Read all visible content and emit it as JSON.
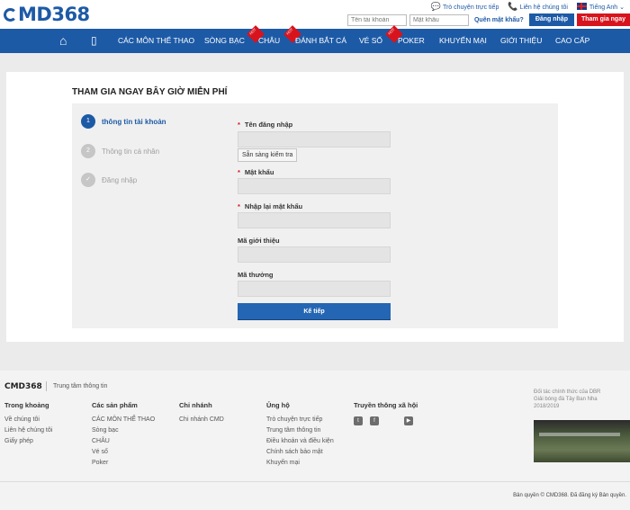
{
  "header": {
    "logo_text": "MD368",
    "top_links": [
      "Trò chuyện trực tiếp",
      "Liên hệ chúng tôi",
      "Tiếng Anh"
    ],
    "username_placeholder": "Tên tài khoản",
    "password_placeholder": "Mật khẩu",
    "forgot_label": "Quên mật khẩu?",
    "login_label": "Đăng nhập",
    "join_label": "Tham gia ngay"
  },
  "nav": {
    "items": [
      "Các môn thể thao",
      "Sòng bạc",
      "Châu",
      "Đánh bắt cá",
      "Vé số",
      "Poker",
      "Khuyến mại",
      "Giới thiệu",
      "Cao cấp"
    ],
    "hot_badge": "HOT"
  },
  "registration": {
    "title": "THAM GIA NGAY BÂY GIỜ MIỄN PHÍ",
    "steps": [
      {
        "num": "1",
        "label": "thông tin tài khoản"
      },
      {
        "num": "2",
        "label": "Thông tin cá nhân"
      },
      {
        "num": "✓",
        "label": "Đăng nhập"
      }
    ],
    "fields": {
      "username_label": "Tên đăng nhập",
      "check_label": "Sẵn sàng kiểm tra",
      "password_label": "Mật khẩu",
      "confirm_label": "Nhập lại mật khẩu",
      "referral_label": "Mã giới thiệu",
      "bonus_label": "Mã thưởng"
    },
    "required_mark": "*",
    "next_label": "Kế tiếp"
  },
  "footer": {
    "logo_text": "CMD368",
    "info_label": "Trung tâm thông tin",
    "columns": [
      {
        "heading": "Trong khoảng",
        "links": [
          "Về chúng tôi",
          "Liên hệ chúng tôi",
          "Giấy phép"
        ]
      },
      {
        "heading": "Các sản phẩm",
        "links": [
          "CÁC MÔN THỂ THAO",
          "Sòng bạc",
          "CHÂU",
          "Vé số",
          "Poker"
        ]
      },
      {
        "heading": "Chi nhánh",
        "links": [
          "Chi nhánh CMD"
        ]
      },
      {
        "heading": "Ủng hộ",
        "links": [
          "Trò chuyện trực tiếp",
          "Trung tâm thông tin",
          "Điều khoản và điều kiện",
          "Chính sách bảo mật",
          "Khuyến mại"
        ]
      }
    ],
    "social_heading": "Truyền thông xã hội",
    "partner_lines": [
      "Đối tác chính thức của DBR",
      "Giải bóng đá Tây Ban Nha",
      "2018/2019"
    ],
    "copyright": "Bản quyền © CMD368. Đã đăng ký Bản quyền."
  },
  "colors": {
    "brand_blue": "#1d5aa6",
    "join_red": "#d7141e"
  }
}
